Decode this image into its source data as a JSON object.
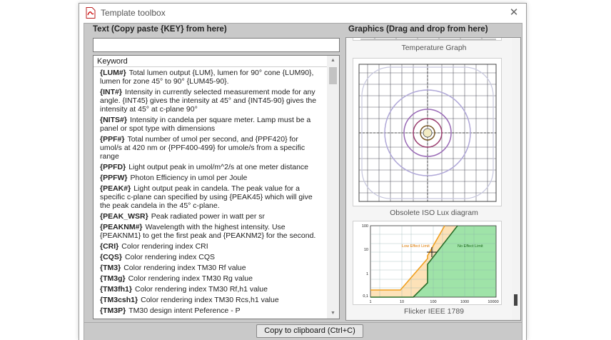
{
  "window": {
    "title": "Template toolbox",
    "close_glyph": "✕",
    "app_icon": "pdf-document-icon"
  },
  "left_panel": {
    "header": "Text (Copy paste {KEY} from here)",
    "search_value": "",
    "list_header": "Keyword",
    "items": [
      {
        "key": "{LUM#}",
        "desc": "Total lumen output {LUM}, lumen for 90° cone {LUM90}, lumen for zone 45° to 90° {LUM45-90}."
      },
      {
        "key": "{INT#}",
        "desc": "Intensity in currently selected measurement mode for any angle. {INT45} gives the intensity at 45° and {INT45-90} gives the intensity at 45° at c-plane 90°"
      },
      {
        "key": "{NITS#}",
        "desc": "Intensity in candela per square meter. Lamp must be a panel or spot type with dimensions"
      },
      {
        "key": "{PPF#}",
        "desc": "Total number of umol per second, and {PPF420} for umol/s at 420 nm or {PPF400-499} for umole/s from a specific range"
      },
      {
        "key": "{PPFD}",
        "desc": "Light output peak in umol/m^2/s at one meter distance"
      },
      {
        "key": "{PPFW}",
        "desc": "Photon Efficiency in umol per Joule"
      },
      {
        "key": "{PEAK#}",
        "desc": "Light output peak in candela. The peak value for a specific c-plane can specified by using {PEAK45} which will give the peak candela in the 45° c-plane."
      },
      {
        "key": "{PEAK_WSR}",
        "desc": "Peak radiated power in watt per sr"
      },
      {
        "key": "{PEAKNM#}",
        "desc": "Wavelength with the highest intensity. Use {PEAKNM1} to get the first peak and {PEAKNM2} for the second."
      },
      {
        "key": "{CRI}",
        "desc": "Color rendering index CRI"
      },
      {
        "key": "{CQS}",
        "desc": "Color rendering index CQS"
      },
      {
        "key": "{TM3}",
        "desc": "Color rendering index TM30 Rf value"
      },
      {
        "key": "{TM3g}",
        "desc": "Color rendering index TM30 Rg value"
      },
      {
        "key": "{TM3fh1}",
        "desc": "Color rendering index TM30 Rf,h1 value"
      },
      {
        "key": "{TM3csh1}",
        "desc": "Color rendering index TM30 Rcs,h1 value"
      },
      {
        "key": "{TM3P}",
        "desc": "TM30 design intent Peference - P"
      }
    ]
  },
  "right_panel": {
    "header": "Graphics (Drag and drop from here)",
    "graphics": [
      {
        "caption": "Temperature Graph"
      },
      {
        "caption": "Obsolete ISO Lux diagram"
      },
      {
        "caption": "Flicker IEEE 1789",
        "labels": {
          "low": "Low Effect Limit",
          "no": "No Effect Limit"
        },
        "y_ticks": [
          "100",
          "10",
          "1",
          "0,1"
        ],
        "x_ticks": [
          "1",
          "10",
          "100",
          "1000",
          "10000"
        ]
      }
    ]
  },
  "footer": {
    "copy_button": "Copy to clipboard (Ctrl+C)"
  }
}
